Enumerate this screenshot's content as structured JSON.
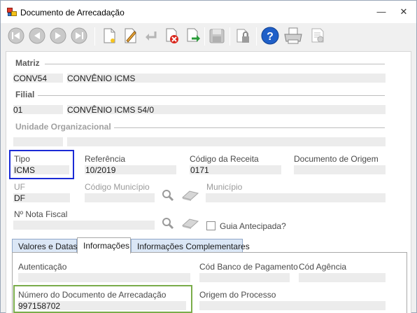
{
  "window": {
    "title": "Documento de Arrecadação",
    "minimize_glyph": "—",
    "close_glyph": "✕"
  },
  "toolbar": {
    "buttons": [
      "first-record-icon",
      "previous-record-icon",
      "next-record-icon",
      "last-record-icon",
      "new-document-icon",
      "edit-pencil-icon",
      "undo-icon",
      "delete-icon",
      "export-arrow-icon",
      "save-disk-icon",
      "lock-icon",
      "help-icon",
      "print-icon",
      "report-icon"
    ],
    "help_glyph": "?"
  },
  "matriz": {
    "header": "Matriz",
    "code": "CONV54",
    "name": "CONVÊNIO ICMS"
  },
  "filial": {
    "header": "Filial",
    "code": "01",
    "name": "CONVÊNIO ICMS 54/0"
  },
  "unidade": {
    "header": "Unidade Organizacional"
  },
  "fields": {
    "tipo_label": "Tipo",
    "tipo_value": "ICMS",
    "referencia_label": "Referência",
    "referencia_value": "10/2019",
    "codigo_receita_label": "Código da Receita",
    "codigo_receita_value": "0171",
    "documento_origem_label": "Documento de Origem",
    "uf_label": "UF",
    "uf_value": "DF",
    "codigo_municipio_label": "Código Município",
    "municipio_label": "Município",
    "nota_fiscal_label": "Nº Nota Fiscal",
    "guia_antecipada_label": "Guia Antecipada?"
  },
  "tabs": [
    {
      "label": "Valores e Datas"
    },
    {
      "label": "Informações"
    },
    {
      "label": "Informações Complementares"
    }
  ],
  "informacoes": {
    "autenticacao_label": "Autenticação",
    "cod_banco_label": "Cód Banco de Pagamento",
    "cod_agencia_label": "Cód Agência",
    "numero_documento_label": "Número do Documento de Arrecadação",
    "numero_documento_value": "997158702",
    "origem_processo_label": "Origem do Processo"
  },
  "colors": {
    "highlight_tipo": "#1b2bd6",
    "highlight_numero": "#7aac4a",
    "active_tab": "#ffffff",
    "inactive_tab": "#dbe7f6"
  }
}
